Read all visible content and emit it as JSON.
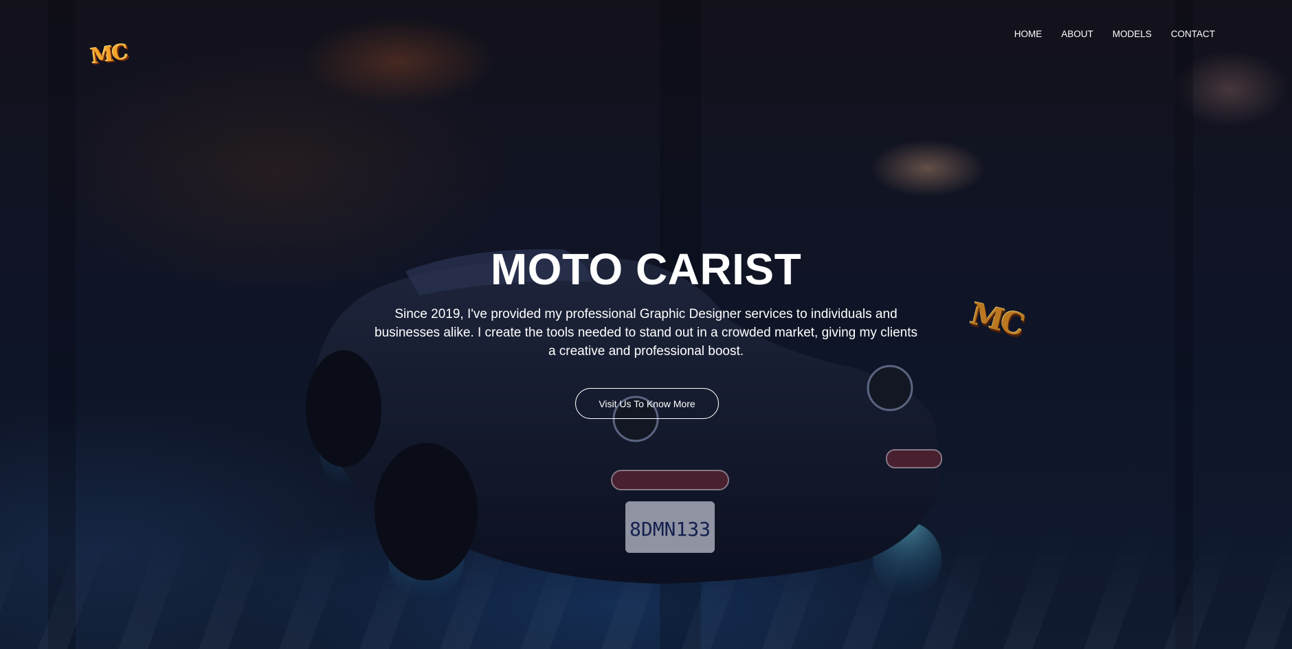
{
  "logo": {
    "text": "MC"
  },
  "nav": {
    "items": [
      {
        "label": "HOME"
      },
      {
        "label": "ABOUT"
      },
      {
        "label": "MODELS"
      },
      {
        "label": "CONTACT"
      }
    ]
  },
  "hero": {
    "title": "MOTO CARIST",
    "description": "Since 2019, I've provided my professional Graphic Designer services to individuals and businesses alike. I create the tools needed to stand out in a crowded market, giving my clients a creative and professional boost.",
    "cta_label": "Visit Us To Know More",
    "badge_text": "MC",
    "plate_text": "8DMN133"
  },
  "colors": {
    "text": "#ffffff",
    "logo_orange": "#f2a42a",
    "background_navy": "#121a2c"
  }
}
